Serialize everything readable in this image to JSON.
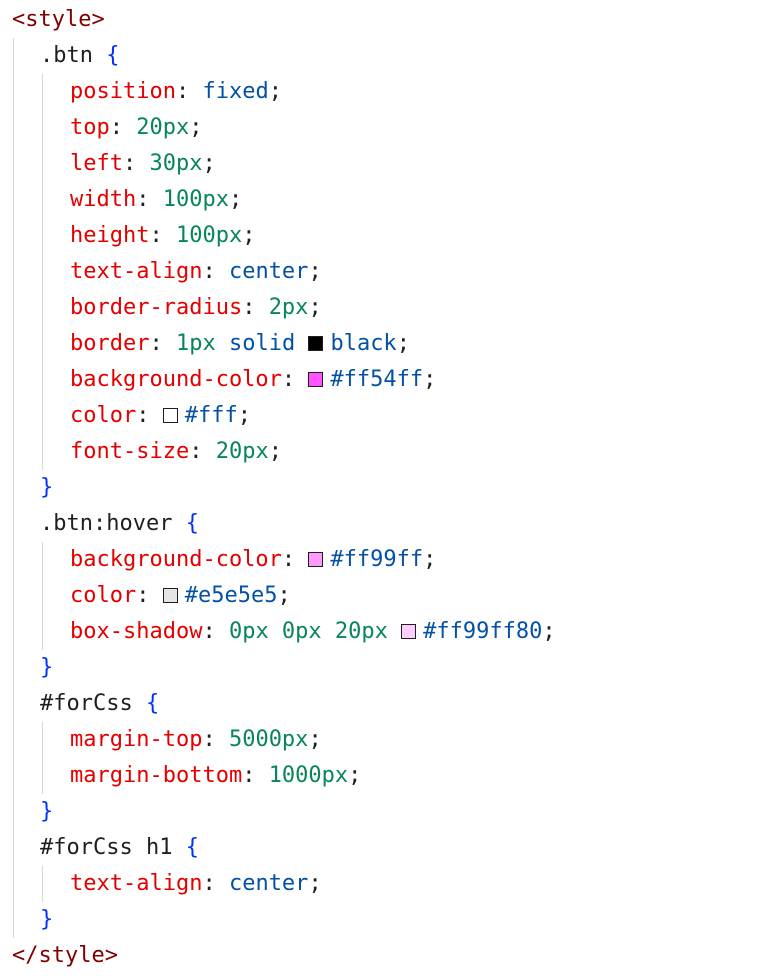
{
  "editor": {
    "style_open": "<style>",
    "style_close": "</style>",
    "rules": [
      {
        "selector": ".btn",
        "decls": [
          {
            "prop": "position",
            "value": [
              {
                "t": "kw",
                "v": "fixed"
              }
            ]
          },
          {
            "prop": "top",
            "value": [
              {
                "t": "num",
                "v": "20px"
              }
            ]
          },
          {
            "prop": "left",
            "value": [
              {
                "t": "num",
                "v": "30px"
              }
            ]
          },
          {
            "prop": "width",
            "value": [
              {
                "t": "num",
                "v": "100px"
              }
            ]
          },
          {
            "prop": "height",
            "value": [
              {
                "t": "num",
                "v": "100px"
              }
            ]
          },
          {
            "prop": "text-align",
            "value": [
              {
                "t": "kw",
                "v": "center"
              }
            ]
          },
          {
            "prop": "border-radius",
            "value": [
              {
                "t": "num",
                "v": "2px"
              }
            ]
          },
          {
            "prop": "border",
            "value": [
              {
                "t": "num",
                "v": "1px"
              },
              {
                "t": "kw",
                "v": " solid "
              },
              {
                "t": "swatch",
                "c": "#000000"
              },
              {
                "t": "kw",
                "v": "black"
              }
            ]
          },
          {
            "prop": "background-color",
            "value": [
              {
                "t": "swatch",
                "c": "#ff54ff"
              },
              {
                "t": "kw",
                "v": "#ff54ff"
              }
            ]
          },
          {
            "prop": "color",
            "value": [
              {
                "t": "swatch",
                "c": "#ffffff"
              },
              {
                "t": "kw",
                "v": "#fff"
              }
            ]
          },
          {
            "prop": "font-size",
            "value": [
              {
                "t": "num",
                "v": "20px"
              }
            ]
          }
        ]
      },
      {
        "selector": ".btn:hover",
        "decls": [
          {
            "prop": "background-color",
            "value": [
              {
                "t": "swatch",
                "c": "#ff99ff"
              },
              {
                "t": "kw",
                "v": "#ff99ff"
              }
            ]
          },
          {
            "prop": "color",
            "value": [
              {
                "t": "swatch",
                "c": "#e5e5e5"
              },
              {
                "t": "kw",
                "v": "#e5e5e5"
              }
            ]
          },
          {
            "prop": "box-shadow",
            "value": [
              {
                "t": "num",
                "v": "0px 0px 20px "
              },
              {
                "t": "swatch",
                "c": "#ffccff"
              },
              {
                "t": "kw",
                "v": "#ff99ff80"
              }
            ]
          }
        ]
      },
      {
        "selector": "#forCss",
        "decls": [
          {
            "prop": "margin-top",
            "value": [
              {
                "t": "num",
                "v": "5000px"
              }
            ]
          },
          {
            "prop": "margin-bottom",
            "value": [
              {
                "t": "num",
                "v": "1000px"
              }
            ]
          }
        ]
      },
      {
        "selector": "#forCss h1",
        "decls": [
          {
            "prop": "text-align",
            "value": [
              {
                "t": "kw",
                "v": "center"
              }
            ]
          }
        ]
      }
    ]
  }
}
